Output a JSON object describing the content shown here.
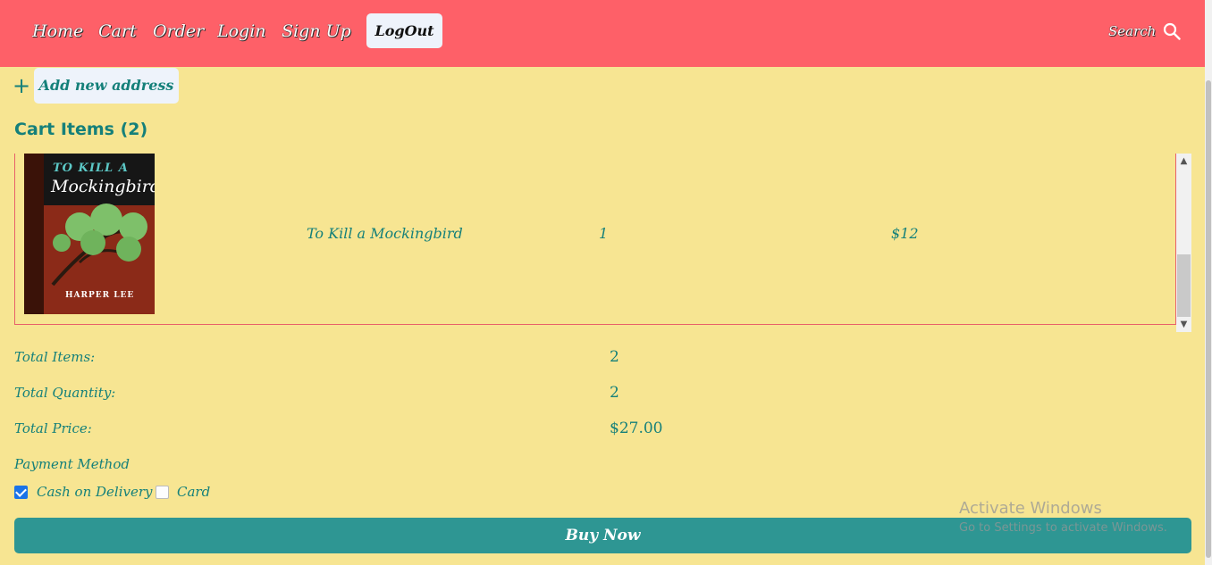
{
  "nav": {
    "links": [
      {
        "label": "Home"
      },
      {
        "label": "Cart"
      },
      {
        "label": "Order"
      },
      {
        "label": "Login"
      },
      {
        "label": "Sign Up"
      }
    ],
    "logout_label": "LogOut",
    "search_label": "Search"
  },
  "address": {
    "plus": "+",
    "add_label": "Add new address"
  },
  "cart": {
    "title": "Cart Items (2)",
    "items": [
      {
        "cover": {
          "line1": "TO KILL A",
          "line2": "Mockingbird",
          "author": "HARPER LEE"
        },
        "name": "To Kill a Mockingbird",
        "quantity": "1",
        "price": "$12"
      }
    ]
  },
  "summary": {
    "total_items_label": "Total Items:",
    "total_items": "2",
    "total_quantity_label": "Total Quantity:",
    "total_quantity": "2",
    "total_price_label": "Total Price:",
    "total_price": "$27.00"
  },
  "payment": {
    "label": "Payment Method",
    "options": [
      {
        "label": "Cash on Delivery",
        "checked": true
      },
      {
        "label": "Card",
        "checked": false
      }
    ]
  },
  "buy_label": "Buy Now",
  "watermark": {
    "line1": "Activate Windows",
    "line2": "Go to Settings to activate Windows."
  },
  "colors": {
    "navbar": "#fe6068",
    "background": "#f7e592",
    "accent": "#15807a",
    "buy_button": "#2e9693"
  }
}
